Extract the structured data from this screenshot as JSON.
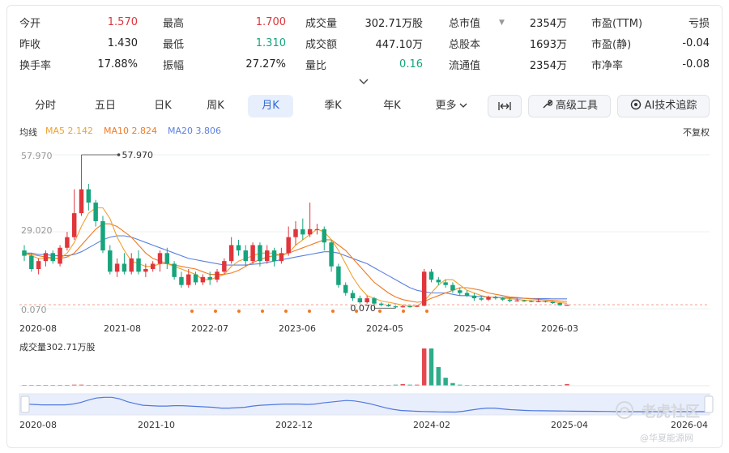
{
  "stats": {
    "rows": [
      [
        {
          "label": "今开",
          "value": "1.570",
          "color": "red"
        },
        {
          "label": "最高",
          "value": "1.700",
          "color": "red"
        },
        {
          "label": "成交量",
          "value": "302.71万股",
          "color": ""
        },
        {
          "label": "总市值",
          "value": "2354万",
          "color": "",
          "caret": "▼"
        },
        {
          "label": "市盈(TTM)",
          "value": "亏损",
          "color": ""
        }
      ],
      [
        {
          "label": "昨收",
          "value": "1.430",
          "color": ""
        },
        {
          "label": "最低",
          "value": "1.310",
          "color": "green"
        },
        {
          "label": "成交额",
          "value": "447.10万",
          "color": ""
        },
        {
          "label": "总股本",
          "value": "1693万",
          "color": ""
        },
        {
          "label": "市盈(静)",
          "value": "-0.04",
          "color": ""
        }
      ],
      [
        {
          "label": "换手率",
          "value": "17.88%",
          "color": ""
        },
        {
          "label": "振幅",
          "value": "27.27%",
          "color": ""
        },
        {
          "label": "量比",
          "value": "0.16",
          "color": "green"
        },
        {
          "label": "流通值",
          "value": "2354万",
          "color": ""
        },
        {
          "label": "市净率",
          "value": "-0.08",
          "color": ""
        }
      ]
    ],
    "expand_icon": "chevron-down-icon"
  },
  "tabs": [
    "分时",
    "五日",
    "日K",
    "周K",
    "月K",
    "季K",
    "年K",
    "更多"
  ],
  "active_tab": "月K",
  "more_caret": "chevron-down-icon",
  "tools": {
    "fit_icon": "expand-horizontal-icon",
    "advanced_label": "高级工具",
    "advanced_icon": "tools-icon",
    "ai_label": "AI技术追踪",
    "ai_icon": "ai-icon"
  },
  "ma": {
    "label": "均线",
    "ma5": "MA5 2.142",
    "ma10": "MA10 2.824",
    "ma20": "MA20 3.806",
    "adjust": "不复权",
    "colors": {
      "ma5": "#f0a12a",
      "ma10": "#f07a22",
      "ma20": "#5a7fe0"
    }
  },
  "colors": {
    "up": "#e0353b",
    "down": "#16a47c",
    "grid": "#eef0f3",
    "dash": "#f4a08c"
  },
  "chart_data": {
    "type": "candlestick",
    "y_ticks": [
      "57.970",
      "29.020",
      "0.070"
    ],
    "ylim": [
      0.07,
      57.97
    ],
    "high_marker": "57.970",
    "low_marker": "0.070",
    "x_labels": [
      "2020-08",
      "2021-08",
      "2022-07",
      "2023-06",
      "2024-05",
      "2025-04",
      "2026-03"
    ],
    "volume_label": "成交量302.71万股",
    "navigator_labels": [
      "2020-08",
      "2021-10",
      "2022-12",
      "2024-02",
      "2025-04",
      "2026-04"
    ],
    "candles": [
      [
        22,
        20,
        24,
        18
      ],
      [
        20,
        15,
        21,
        14
      ],
      [
        15,
        18,
        19,
        13
      ],
      [
        18,
        21,
        22,
        16
      ],
      [
        21,
        18,
        22,
        17
      ],
      [
        17,
        23,
        24,
        16
      ],
      [
        23,
        27,
        29,
        22
      ],
      [
        27,
        36,
        45,
        26
      ],
      [
        36,
        45,
        57.97,
        35
      ],
      [
        45,
        40,
        47,
        37
      ],
      [
        40,
        33,
        41,
        31
      ],
      [
        33,
        22,
        35,
        21
      ],
      [
        22,
        14,
        24,
        13
      ],
      [
        14,
        17,
        19,
        12
      ],
      [
        17,
        14,
        21,
        13
      ],
      [
        14,
        19,
        21,
        13
      ],
      [
        19,
        14,
        22,
        13
      ],
      [
        14,
        15,
        17,
        12
      ],
      [
        15,
        17,
        18,
        14
      ],
      [
        17,
        21,
        22,
        14
      ],
      [
        21,
        17,
        23,
        15
      ],
      [
        17,
        12,
        18,
        11
      ],
      [
        12,
        9,
        14,
        8
      ],
      [
        9,
        13,
        15,
        8
      ],
      [
        13,
        10,
        14,
        9
      ],
      [
        10,
        12,
        13,
        9
      ],
      [
        12,
        11,
        14,
        9
      ],
      [
        11,
        14,
        15,
        10
      ],
      [
        14,
        18,
        19,
        13
      ],
      [
        18,
        24,
        27,
        17
      ],
      [
        24,
        22,
        26,
        20
      ],
      [
        22,
        18,
        24,
        16
      ],
      [
        18,
        24,
        25,
        17
      ],
      [
        24,
        18,
        25,
        16
      ],
      [
        18,
        22,
        24,
        17
      ],
      [
        22,
        18,
        23,
        16
      ],
      [
        18,
        21,
        23,
        17
      ],
      [
        21,
        27,
        31,
        20
      ],
      [
        27,
        30,
        33,
        24
      ],
      [
        30,
        28,
        34,
        26
      ],
      [
        28,
        30,
        40,
        27
      ],
      [
        30,
        30,
        32,
        28
      ],
      [
        30,
        25,
        31,
        22
      ],
      [
        25,
        16,
        26,
        14
      ],
      [
        16,
        9,
        17,
        8
      ],
      [
        9,
        6,
        10,
        5
      ],
      [
        6,
        4,
        7,
        3
      ],
      [
        4,
        2.5,
        5,
        2
      ],
      [
        2.5,
        4,
        5,
        2
      ],
      [
        4,
        2,
        4.5,
        1.5
      ],
      [
        2,
        1.5,
        2.5,
        1
      ],
      [
        1.5,
        1,
        2,
        0.8
      ],
      [
        1,
        0.6,
        1.2,
        0.3
      ],
      [
        0.6,
        1,
        1.5,
        0.5
      ],
      [
        1,
        0.8,
        1.2,
        0.5
      ],
      [
        0.8,
        1.2,
        1.5,
        0.7
      ],
      [
        1.2,
        14,
        15,
        1
      ],
      [
        14,
        11,
        15,
        10
      ],
      [
        11,
        10,
        12,
        9
      ],
      [
        10,
        9,
        11,
        8
      ],
      [
        9,
        7,
        10,
        6
      ],
      [
        7,
        6,
        8,
        5
      ],
      [
        6,
        5,
        7,
        4.5
      ],
      [
        5,
        4,
        6,
        3
      ],
      [
        4,
        3.5,
        5,
        3
      ],
      [
        3.5,
        4.5,
        5,
        3
      ],
      [
        4.5,
        4,
        5,
        3.5
      ],
      [
        4,
        3.5,
        4.5,
        3
      ],
      [
        3.5,
        3,
        4,
        2.5
      ],
      [
        3,
        3.2,
        4,
        2.8
      ],
      [
        3.2,
        3,
        3.5,
        2.7
      ],
      [
        3,
        2.8,
        3.3,
        2.5
      ],
      [
        2.8,
        3,
        4,
        2.5
      ],
      [
        3,
        2.7,
        3.1,
        2.4
      ],
      [
        2.7,
        2.2,
        2.9,
        1.9
      ],
      [
        2.2,
        1.4,
        2.4,
        1.2
      ],
      [
        1.43,
        1.57,
        1.7,
        1.31
      ]
    ],
    "volume": [
      1,
      1,
      1,
      1,
      1,
      1,
      1,
      2,
      2,
      1,
      1,
      1,
      1,
      1,
      1,
      1,
      1,
      1,
      1,
      1,
      1,
      1,
      1,
      1,
      1,
      1,
      1,
      1,
      1,
      1,
      1,
      1,
      1,
      1,
      1,
      1,
      1,
      1,
      1,
      1,
      1,
      1,
      1,
      1,
      1,
      1,
      1,
      1,
      1,
      1,
      1,
      1,
      2,
      3,
      2,
      2,
      70,
      70,
      35,
      15,
      5,
      2,
      1,
      1,
      1,
      1,
      1,
      1,
      1,
      1,
      1,
      1,
      1,
      1,
      1,
      1,
      3
    ],
    "ma5": [
      21,
      20,
      19,
      19,
      19,
      19,
      21,
      25,
      31,
      36,
      38,
      38,
      34,
      27,
      22,
      18,
      17,
      16,
      16,
      17,
      17,
      16,
      15,
      14,
      13,
      11,
      11,
      12,
      13,
      16,
      18,
      19,
      20,
      21,
      21,
      21,
      20,
      21,
      24,
      26,
      28,
      30,
      29,
      26,
      22,
      17,
      12,
      8,
      5,
      4,
      3,
      2.5,
      2,
      1.4,
      1.2,
      1,
      3,
      6,
      9,
      11,
      11,
      9,
      7,
      6,
      5,
      4.5,
      4.3,
      4.1,
      3.9,
      3.6,
      3.3,
      3.1,
      3,
      2.9,
      2.7,
      2.4,
      2.1
    ],
    "ma10": [
      21,
      20.5,
      20,
      19.5,
      19.2,
      19,
      19.5,
      21,
      24,
      27,
      30,
      32,
      32,
      31,
      29,
      27,
      24,
      21,
      19,
      18,
      17,
      16.5,
      16,
      15.5,
      15,
      14,
      13,
      13,
      13,
      13.5,
      14.5,
      16,
      17.5,
      18.5,
      19.5,
      20,
      20.5,
      21,
      22,
      23,
      24,
      25,
      26,
      26,
      24,
      22,
      19,
      16,
      13,
      10,
      8,
      6,
      4.5,
      3.5,
      3,
      2.5,
      2.8,
      4,
      5,
      6,
      7,
      8,
      8,
      7.5,
      7,
      6,
      5.5,
      5,
      4.5,
      4.3,
      4,
      3.8,
      3.6,
      3.4,
      3.2,
      3,
      2.8
    ],
    "ma20": [
      21,
      21,
      20.5,
      20.5,
      20,
      20,
      20,
      20.5,
      21.5,
      23,
      24.5,
      26,
      27,
      27.5,
      27.5,
      27,
      26,
      25,
      24,
      23,
      22,
      21,
      20,
      19,
      18.5,
      18,
      17.5,
      17,
      16.5,
      16.5,
      16.5,
      16.5,
      16.8,
      17,
      17.5,
      18,
      18.5,
      19,
      19.5,
      20,
      20.5,
      21,
      21.5,
      21.5,
      21,
      20,
      19,
      18,
      17,
      15.5,
      14,
      12.5,
      11,
      9.5,
      8,
      7,
      6.5,
      6,
      6,
      6,
      5.5,
      5,
      5,
      4.8,
      4.6,
      4.5,
      4.4,
      4.3,
      4.2,
      4.1,
      4,
      3.9,
      3.9,
      3.85,
      3.8,
      3.8,
      3.8
    ],
    "markers": [
      8,
      9,
      10,
      11,
      12,
      13,
      14,
      15,
      16,
      17,
      18
    ]
  },
  "watermark": {
    "brand": "老虎社区",
    "source": "@华夏能源网"
  }
}
